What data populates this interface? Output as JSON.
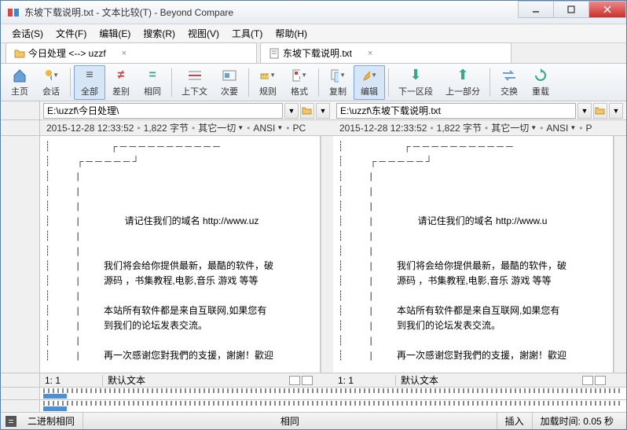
{
  "window": {
    "title": "东坡下载说明.txt - 文本比较(T) - Beyond Compare"
  },
  "menu": {
    "session": "会话(S)",
    "file": "文件(F)",
    "edit": "编辑(E)",
    "search": "搜索(R)",
    "view": "视图(V)",
    "tools": "工具(T)",
    "help": "帮助(H)"
  },
  "tabs": {
    "t1": "今日处理 <--> uzzf",
    "t2": "东坡下载说明.txt"
  },
  "toolbar": {
    "home": "主页",
    "sessions": "会话",
    "all": "全部",
    "diff": "差别",
    "same": "相同",
    "context": "上下文",
    "minor": "次要",
    "rules": "规则",
    "format": "格式",
    "copy": "复制",
    "editbtn": "编辑",
    "nextsec": "下一区段",
    "prevpart": "上一部分",
    "swap": "交换",
    "reload": "重载"
  },
  "paths": {
    "left": "E:\\uzzf\\今日处理\\",
    "right": "E:\\uzzf\\东坡下载说明.txt"
  },
  "info": {
    "timestamp": "2015-12-28 12:33:52",
    "size": "1,822 字节",
    "everything": "其它一切",
    "encoding": "ANSI",
    "platformL": "PC",
    "platformR": "P"
  },
  "text": {
    "line_domain": "        请记住我们的域名 http://www.uz",
    "line_domain_r": "        请记住我们的域名 http://www.u",
    "line_provide": "我们将会给你提供最新，最酷的软件，破",
    "line_source": "源码 ，书集教程,电影,音乐 游戏 等等",
    "line_site": "本站所有软件都是来自互联网,如果您有",
    "line_forum": "到我们的论坛发表交流。",
    "line_thanks": "再一次感谢您對我們的支援，謝謝！歡迎"
  },
  "position": {
    "pos": "1: 1",
    "mode": "默认文本"
  },
  "status": {
    "binary": "二进制相同",
    "same": "相同",
    "insert": "插入",
    "loadtime": "加载时间: 0.05 秒"
  }
}
